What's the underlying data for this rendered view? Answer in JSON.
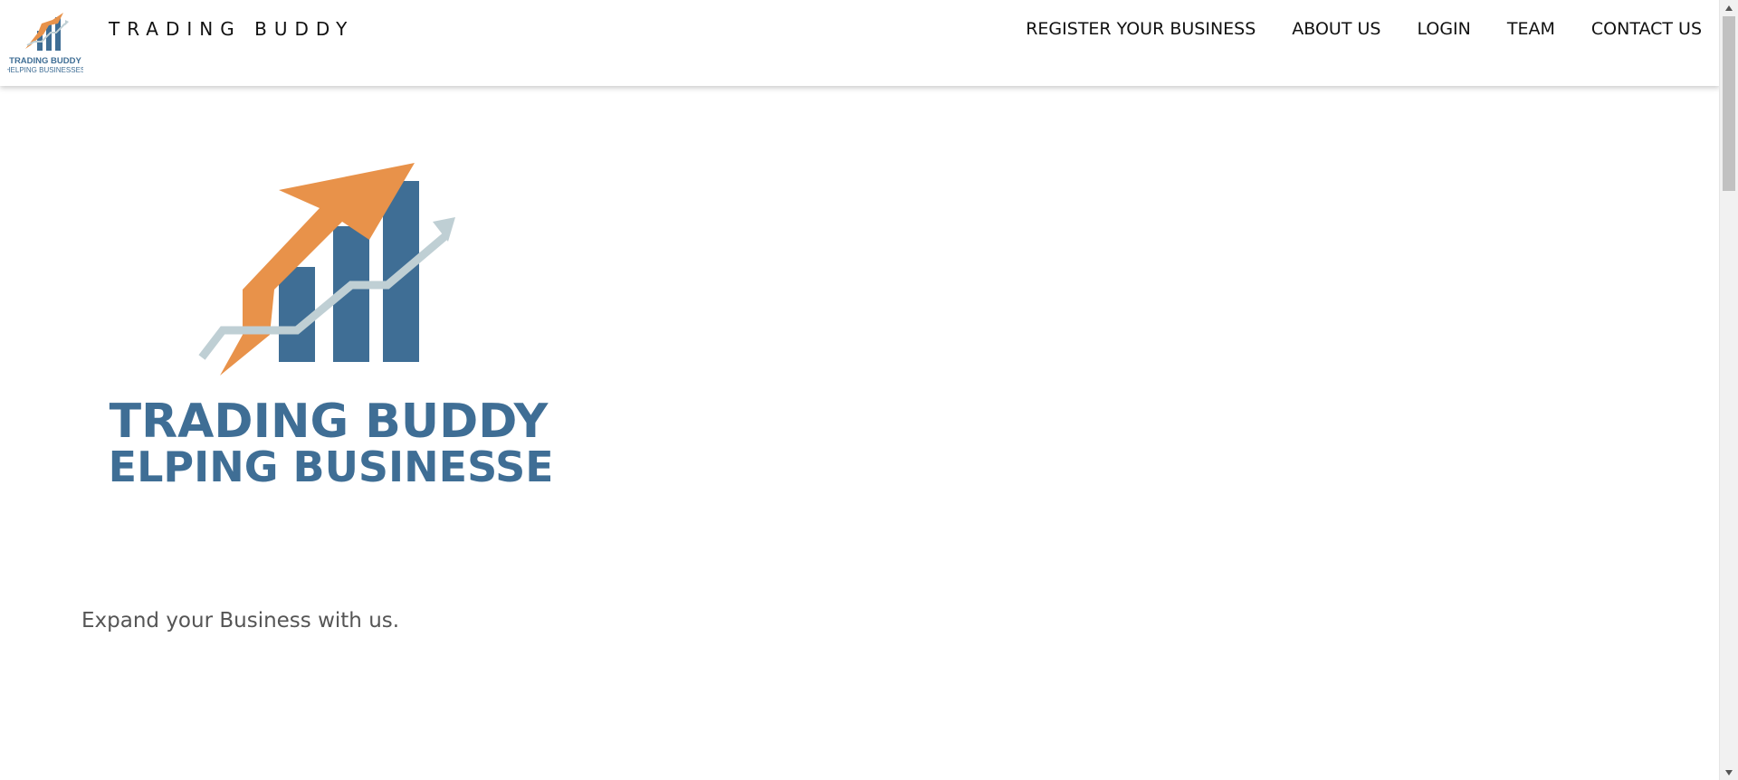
{
  "header": {
    "brand_title": "TRADING BUDDY",
    "logo": {
      "line1": "TRADING BUDDY",
      "line2": "HELPING BUSINESSES"
    }
  },
  "nav": {
    "items": [
      {
        "label": "REGISTER YOUR BUSINESS"
      },
      {
        "label": "ABOUT US"
      },
      {
        "label": "LOGIN"
      },
      {
        "label": "TEAM"
      },
      {
        "label": "CONTACT US"
      }
    ]
  },
  "hero": {
    "logo": {
      "line1": "TRADING BUDDY",
      "line2": "HELPING BUSINESSES"
    },
    "tagline": "Expand your Business with us."
  },
  "colors": {
    "orange": "#E8924A",
    "blue": "#3F6E95",
    "trend": "#BFCFD4",
    "text": "#111111",
    "tagline": "#555555"
  },
  "icons": {
    "logo": "trading-buddy-logo",
    "scroll_up": "chevron-up-icon",
    "scroll_down": "chevron-down-icon"
  }
}
